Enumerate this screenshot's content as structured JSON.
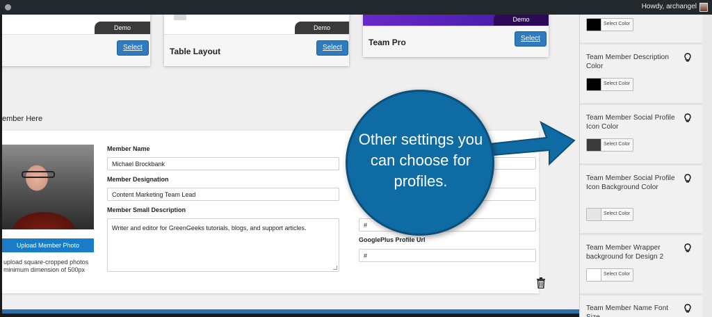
{
  "admin_bar": {
    "greeting": "Howdy, archangel"
  },
  "layouts": [
    {
      "demo_label": "Demo",
      "title": "",
      "select_label": "Select"
    },
    {
      "demo_label": "Demo",
      "title": "Table Layout",
      "select_label": "Select"
    },
    {
      "demo_label": "Demo",
      "title": "Team Pro",
      "select_label": "Select"
    }
  ],
  "member_section": {
    "heading": "ember Here"
  },
  "member_form": {
    "upload_button": "Upload Member Photo",
    "upload_note_line1": "upload square-cropped photos",
    "upload_note_line2": "minimum dimension of 500px",
    "name_label": "Member Name",
    "name_value": "Michael Brockbank",
    "designation_label": "Member Designation",
    "designation_value": "Content Marketing Team Lead",
    "description_label": "Member Small Description",
    "description_value": "Writer and editor for GreenGeeks tutorials, blogs, and support articles.",
    "right_field_value": "#",
    "googleplus_label": "GooglePlus Profile Url",
    "googleplus_value": "#"
  },
  "callout": {
    "text": "Other settings you can choose for profiles.",
    "color": "#0f6ba3"
  },
  "sidebar": {
    "settings": [
      {
        "label": "",
        "button": "Select Color",
        "swatch": "#000000"
      },
      {
        "label": "Team Member Description Color",
        "button": "Select Color",
        "swatch": "#000000"
      },
      {
        "label": "Team Member Social Profile Icon Color",
        "button": "Select Color",
        "swatch": "#3b3b3b"
      },
      {
        "label": "Team Member Social Profile Icon Background Color",
        "button": "Select Color",
        "swatch": "#e6e6e6"
      },
      {
        "label": "Team Member Wrapper background for Design 2",
        "button": "Select Color",
        "swatch": "#ffffff"
      },
      {
        "label": "Team Member Name Font Size",
        "button": "",
        "swatch": ""
      }
    ]
  }
}
